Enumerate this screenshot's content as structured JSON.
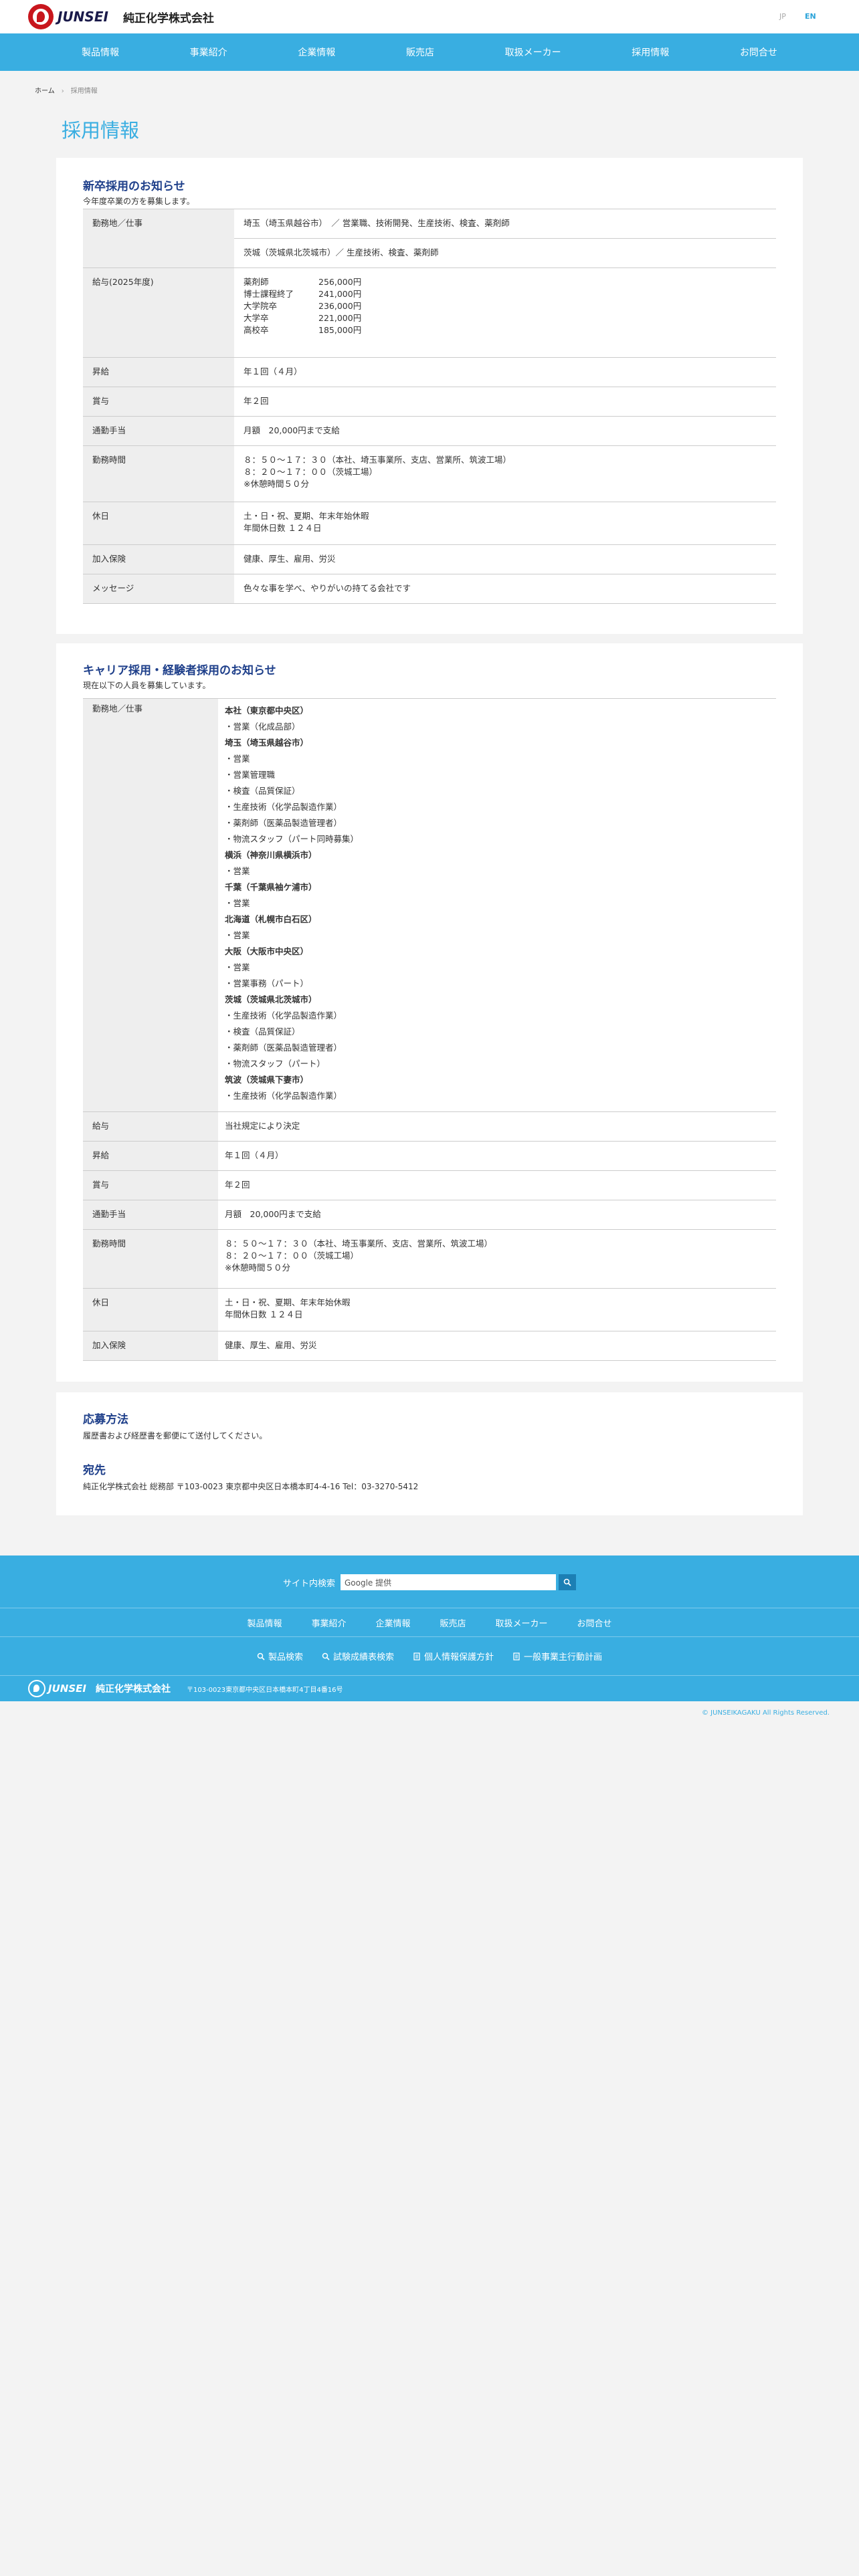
{
  "header": {
    "logo_en": "JUNSEI",
    "logo_ja": "純正化学株式会社",
    "lang_jp": "JP",
    "lang_en": "EN"
  },
  "gnav": [
    "製品情報",
    "事業紹介",
    "企業情報",
    "販売店",
    "取扱メーカー",
    "採用情報",
    "お問合せ"
  ],
  "breadcrumb": {
    "home": "ホーム",
    "sep": "›",
    "current": "採用情報"
  },
  "page_title": "採用情報",
  "new_grad": {
    "title": "新卒採用のお知らせ",
    "subtitle": "今年度卒業の方を募集します。",
    "rows": {
      "location_label": "勤務地／仕事",
      "location_1": "埼玉（埼玉県越谷市）　／ 営業職、技術開発、生産技術、検査、薬剤師",
      "location_2": "茨城（茨城県北茨城市）／ 生産技術、検査、薬剤師",
      "salary_label": "給与(2025年度)",
      "salary": [
        [
          "薬剤師",
          "256,000円"
        ],
        [
          "博士課程終了",
          "241,000円"
        ],
        [
          "大学院卒",
          "236,000円"
        ],
        [
          "大学卒",
          "221,000円"
        ],
        [
          "高校卒",
          "185,000円"
        ]
      ],
      "raise_label": "昇給",
      "raise": "年１回（４月）",
      "bonus_label": "賞与",
      "bonus": "年２回",
      "commute_label": "通勤手当",
      "commute": "月額　20,000円まで支給",
      "hours_label": "勤務時間",
      "hours_1": "８：５０〜１７：３０（本社、埼玉事業所、支店、営業所、筑波工場）",
      "hours_2": "８：２０〜１７：００（茨城工場）",
      "hours_3": "※休憩時間５０分",
      "holiday_label": "休日",
      "holiday_1": "土・日・祝、夏期、年末年始休暇",
      "holiday_2": "年間休日数 １２４日",
      "insurance_label": "加入保険",
      "insurance": "健康、厚生、雇用、労災",
      "message_label": "メッセージ",
      "message": "色々な事を学べ、やりがいの持てる会社です"
    }
  },
  "career": {
    "title": "キャリア採用・経験者採用のお知らせ",
    "subtitle": "現在以下の人員を募集しています。",
    "location_label": "勤務地／仕事",
    "locations": [
      {
        "text": "本社（東京都中央区）",
        "bold": true
      },
      {
        "text": "・営業（化成品部）",
        "bold": false
      },
      {
        "text": "埼玉（埼玉県越谷市）",
        "bold": true
      },
      {
        "text": "・営業",
        "bold": false
      },
      {
        "text": "・営業管理職",
        "bold": false
      },
      {
        "text": "・検査（品質保証）",
        "bold": false
      },
      {
        "text": "・生産技術（化学品製造作業）",
        "bold": false
      },
      {
        "text": "・薬剤師（医薬品製造管理者）",
        "bold": false
      },
      {
        "text": "・物流スタッフ（パート同時募集）",
        "bold": false
      },
      {
        "text": "横浜（神奈川県横浜市）",
        "bold": true
      },
      {
        "text": "・営業",
        "bold": false
      },
      {
        "text": "千葉（千葉県袖ケ浦市）",
        "bold": true
      },
      {
        "text": "・営業",
        "bold": false
      },
      {
        "text": "北海道（札幌市白石区）",
        "bold": true
      },
      {
        "text": "・営業",
        "bold": false
      },
      {
        "text": "大阪（大阪市中央区）",
        "bold": true
      },
      {
        "text": "・営業",
        "bold": false
      },
      {
        "text": "・営業事務（パート）",
        "bold": false
      },
      {
        "text": "茨城（茨城県北茨城市）",
        "bold": true
      },
      {
        "text": "・生産技術（化学品製造作業）",
        "bold": false
      },
      {
        "text": "・検査（品質保証）",
        "bold": false
      },
      {
        "text": "・薬剤師（医薬品製造管理者）",
        "bold": false
      },
      {
        "text": "・物流スタッフ（パート）",
        "bold": false
      },
      {
        "text": "筑波（茨城県下妻市）",
        "bold": true
      },
      {
        "text": "・生産技術（化学品製造作業）",
        "bold": false
      }
    ],
    "salary_label": "給与",
    "salary": "当社規定により決定",
    "raise_label": "昇給",
    "raise": "年１回（４月）",
    "bonus_label": "賞与",
    "bonus": "年２回",
    "commute_label": "通勤手当",
    "commute": "月額　20,000円まで支給",
    "hours_label": "勤務時間",
    "hours_1": "８：５０〜１７：３０（本社、埼玉事業所、支店、営業所、筑波工場）",
    "hours_2": "８：２０〜１７：００（茨城工場）",
    "hours_3": "※休憩時間５０分",
    "holiday_label": "休日",
    "holiday_1": "土・日・祝、夏期、年末年始休暇",
    "holiday_2": "年間休日数 １２４日",
    "insurance_label": "加入保険",
    "insurance": "健康、厚生、雇用、労災"
  },
  "apply": {
    "title": "応募方法",
    "text": "履歴書および経歴書を郵便にて送付してください。",
    "addr_title": "宛先",
    "addr": "純正化学株式会社 総務部 〒103-0023 東京都中央区日本橋本町4-4-16 Tel：03-3270-5412"
  },
  "footer": {
    "search_label": "サイト内検索",
    "search_placeholder": "Google 提供",
    "nav1": [
      "製品情報",
      "事業紹介",
      "企業情報",
      "販売店",
      "取扱メーカー",
      "お問合せ"
    ],
    "nav2": [
      "製品検索",
      "試験成績表検索",
      "個人情報保護方針",
      "一般事業主行動計画"
    ],
    "logo_en": "JUNSEI",
    "logo_ja": "純正化学株式会社",
    "address": "〒103-0023東京都中央区日本橋本町4丁目4番16号",
    "copyright": "© JUNSEIKAGAKU All Rights Reserved."
  }
}
